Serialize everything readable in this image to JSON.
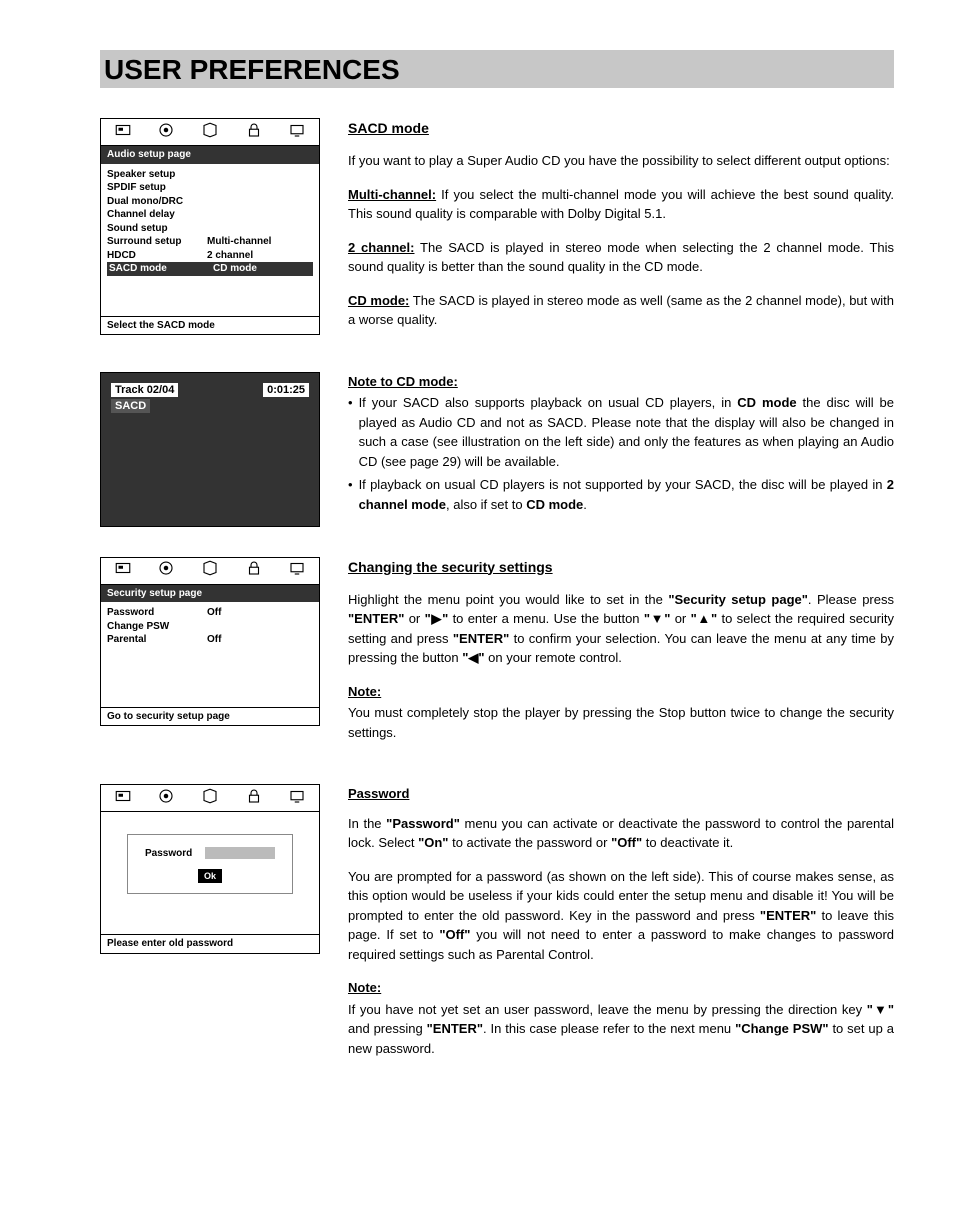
{
  "page_title": "USER PREFERENCES",
  "osd1": {
    "bar": "Audio setup page",
    "items": [
      {
        "l": "Speaker setup",
        "r": ""
      },
      {
        "l": "SPDIF setup",
        "r": ""
      },
      {
        "l": "Dual mono/DRC",
        "r": ""
      },
      {
        "l": "Channel delay",
        "r": ""
      },
      {
        "l": "Sound setup",
        "r": ""
      },
      {
        "l": "Surround setup",
        "r": "Multi-channel"
      },
      {
        "l": "HDCD",
        "r": "2 channel"
      },
      {
        "l": "SACD mode",
        "r": "CD mode",
        "sel": true
      }
    ],
    "foot": "Select the SACD mode"
  },
  "track": {
    "line1": "Track 02/04",
    "time": "0:01:25",
    "tag": "SACD"
  },
  "sacd": {
    "title": "SACD mode",
    "intro": "If you want to play a Super Audio CD you have the possibility to select different output options:",
    "mc_label": "Multi-channel:",
    "mc_body": " If you select the multi-channel mode you will achieve the best sound quality. This sound quality is comparable with Dolby Digital 5.1.",
    "ch_label": "2 channel:",
    "ch_body": " The SACD is played in stereo mode when selecting the 2 channel mode. This sound quality is better than the sound quality in the CD mode.",
    "cd_label": "CD mode:",
    "cd_body": " The SACD is played in stereo mode as well (same as the 2 channel mode), but with a worse quality.",
    "note_label": "Note to CD mode:",
    "b1a": "If your SACD also supports playback on usual CD players, in ",
    "b1b": "CD mode",
    "b1c": " the disc will be played as Audio CD and not as SACD. Please note that the display will also be changed in such a case (see illustration on the left side) and only the features as when playing an Audio CD (see page 29) will be available.",
    "b2a": "If playback on usual CD players is not supported by your SACD, the disc will be played in ",
    "b2b": "2 channel mode",
    "b2c": ", also if set to ",
    "b2d": "CD mode",
    "b2e": "."
  },
  "osd2": {
    "bar": "Security setup page",
    "items": [
      {
        "l": "Password",
        "r": "Off"
      },
      {
        "l": "Change PSW",
        "r": ""
      },
      {
        "l": "Parental",
        "r": "Off"
      }
    ],
    "foot": "Go to security setup page"
  },
  "sec": {
    "title": "Changing the security settings",
    "p1a": "Highlight the menu point you would like to set in the ",
    "p1b": "\"Security setup page\"",
    "p1c": ". Please press ",
    "p1d": "\"ENTER\"",
    "p1e": " or ",
    "p1f": "\"▶\"",
    "p1g": " to enter a menu. Use the button ",
    "p1h": "\"▼\"",
    "p1i": " or ",
    "p1j": "\"▲\"",
    "p1k": " to select the required security setting and press ",
    "p1l": "\"ENTER\"",
    "p1m": " to confirm your selection. You can leave the menu at any time by pressing the button ",
    "p1n": "\"◀\"",
    "p1o": " on your remote control.",
    "note": "Note:",
    "note_body": "You must completely stop the player by pressing the Stop button twice to change the security settings."
  },
  "osd3": {
    "pw_label": "Password",
    "ok": "Ok",
    "foot": "Please enter old password"
  },
  "pw": {
    "title": "Password",
    "p1a": "In the ",
    "p1b": "\"Password\"",
    "p1c": " menu you can activate or deactivate the password to control the parental lock. Select ",
    "p1d": "\"On\"",
    "p1e": " to activate the password or ",
    "p1f": "\"Off\"",
    "p1g": " to deactivate it.",
    "p2a": "You are prompted for a password (as shown on the left side). This of course makes sense, as this option would be useless if your kids could enter the setup menu and disable it! You will be prompted to enter the old password. Key in the password and press ",
    "p2b": "\"ENTER\"",
    "p2c": " to leave this page. If set to ",
    "p2d": "\"Off\"",
    "p2e": " you will not need to enter a password to make changes to password required settings such as Parental Control.",
    "note": "Note: ",
    "n1a": "If you have not yet set an user password, leave the menu by pressing the direction key ",
    "n1b": "\"▼\"",
    "n1c": " and pressing ",
    "n1d": "\"ENTER\"",
    "n1e": ". In this case please refer to the next menu ",
    "n1f": "\"Change PSW\"",
    "n1g": " to set up a new password."
  }
}
